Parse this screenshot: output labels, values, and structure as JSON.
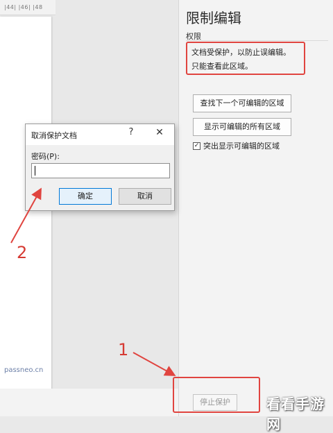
{
  "ruler": {
    "text": "|44|  |46|  |48"
  },
  "watermark": "passneo.cn",
  "pane": {
    "title": "限制编辑",
    "section_label": "权限",
    "status_line1": "文档受保护，以防止误编辑。",
    "status_line2": "只能查看此区域。",
    "find_next_label": "查找下一个可编辑的区域",
    "show_all_label": "显示可编辑的所有区域",
    "highlight_label": "突出显示可编辑的区域",
    "highlight_checked": true,
    "stop_label": "停止保护"
  },
  "dialog": {
    "title": "取消保护文档",
    "help_glyph": "?",
    "close_glyph": "✕",
    "password_label": "密码(P):",
    "password_value": "",
    "ok_label": "确定",
    "cancel_label": "取消"
  },
  "annotations": {
    "step1": "1",
    "step2": "2",
    "color": "#e0443f"
  },
  "corner_watermark": "看看手游网"
}
